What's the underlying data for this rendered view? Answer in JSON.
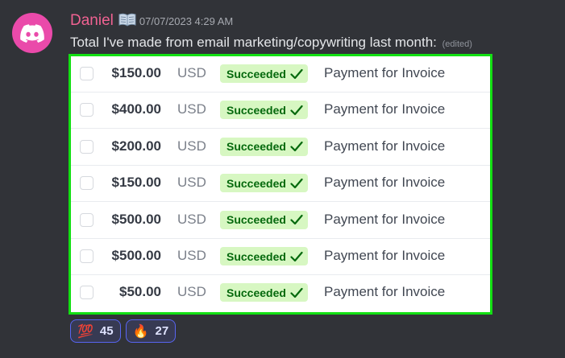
{
  "message": {
    "username": "Daniel",
    "timestamp": "07/07/2023 4:29 AM",
    "text": "Total I've made from email marketing/copywriting last month:",
    "edited_label": "(edited)",
    "badge_icon": "book-icon"
  },
  "payments": [
    {
      "amount": "$150.00",
      "currency": "USD",
      "status": "Succeeded",
      "description": "Payment for Invoice"
    },
    {
      "amount": "$400.00",
      "currency": "USD",
      "status": "Succeeded",
      "description": "Payment for Invoice"
    },
    {
      "amount": "$200.00",
      "currency": "USD",
      "status": "Succeeded",
      "description": "Payment for Invoice"
    },
    {
      "amount": "$150.00",
      "currency": "USD",
      "status": "Succeeded",
      "description": "Payment for Invoice"
    },
    {
      "amount": "$500.00",
      "currency": "USD",
      "status": "Succeeded",
      "description": "Payment for Invoice"
    },
    {
      "amount": "$500.00",
      "currency": "USD",
      "status": "Succeeded",
      "description": "Payment for Invoice"
    },
    {
      "amount": "$50.00",
      "currency": "USD",
      "status": "Succeeded",
      "description": "Payment for Invoice"
    }
  ],
  "reactions": [
    {
      "emoji": "💯",
      "icon": "hundred-points-icon",
      "count": "45"
    },
    {
      "emoji": "🔥",
      "icon": "fire-icon",
      "count": "27"
    }
  ],
  "colors": {
    "background": "#313338",
    "username": "#f06292",
    "avatar": "#ea4aaa",
    "highlight_border": "#12e012",
    "status_badge_bg": "#d7f7c2",
    "status_badge_text": "#05690d",
    "reaction_border": "#5865f2"
  }
}
